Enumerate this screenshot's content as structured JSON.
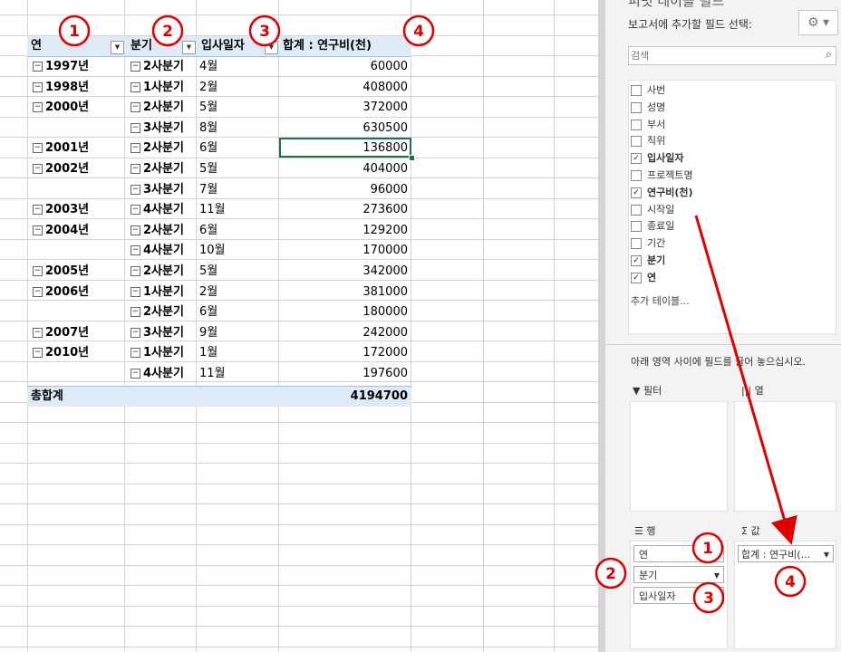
{
  "pivot": {
    "header": {
      "c1": "연",
      "c2": "분기",
      "c3": "입사일자",
      "c4": "합계 : 연구비(천)"
    },
    "rows": [
      {
        "year": "1997년",
        "quarter": "2사분기",
        "month": "4월",
        "value": "60000"
      },
      {
        "year": "1998년",
        "quarter": "1사분기",
        "month": "2월",
        "value": "408000"
      },
      {
        "year": "2000년",
        "quarter": "2사분기",
        "month": "5월",
        "value": "372000"
      },
      {
        "year": "",
        "quarter": "3사분기",
        "month": "8월",
        "value": "630500"
      },
      {
        "year": "2001년",
        "quarter": "2사분기",
        "month": "6월",
        "value": "136800"
      },
      {
        "year": "2002년",
        "quarter": "2사분기",
        "month": "5월",
        "value": "404000"
      },
      {
        "year": "",
        "quarter": "3사분기",
        "month": "7월",
        "value": "96000"
      },
      {
        "year": "2003년",
        "quarter": "4사분기",
        "month": "11월",
        "value": "273600"
      },
      {
        "year": "2004년",
        "quarter": "2사분기",
        "month": "6월",
        "value": "129200"
      },
      {
        "year": "",
        "quarter": "4사분기",
        "month": "10월",
        "value": "170000"
      },
      {
        "year": "2005년",
        "quarter": "2사분기",
        "month": "5월",
        "value": "342000"
      },
      {
        "year": "2006년",
        "quarter": "1사분기",
        "month": "2월",
        "value": "381000"
      },
      {
        "year": "",
        "quarter": "2사분기",
        "month": "6월",
        "value": "180000"
      },
      {
        "year": "2007년",
        "quarter": "3사분기",
        "month": "9월",
        "value": "242000"
      },
      {
        "year": "2010년",
        "quarter": "1사분기",
        "month": "1월",
        "value": "172000"
      },
      {
        "year": "",
        "quarter": "4사분기",
        "month": "11월",
        "value": "197600"
      }
    ],
    "total": {
      "label": "총합계",
      "value": "4194700"
    },
    "collapse_glyph": "⊟"
  },
  "panel": {
    "title": "피벗 테이블 필드",
    "prompt": "보고서에 추가할 필드 선택:",
    "search_placeholder": "검색",
    "fields": [
      {
        "label": "사번",
        "checked": false
      },
      {
        "label": "성명",
        "checked": false
      },
      {
        "label": "부서",
        "checked": false
      },
      {
        "label": "직위",
        "checked": false
      },
      {
        "label": "입사일자",
        "checked": true
      },
      {
        "label": "프로젝트명",
        "checked": false
      },
      {
        "label": "연구비(천)",
        "checked": true
      },
      {
        "label": "시작일",
        "checked": false
      },
      {
        "label": "종료일",
        "checked": false
      },
      {
        "label": "기간",
        "checked": false
      },
      {
        "label": "분기",
        "checked": true
      },
      {
        "label": "연",
        "checked": true
      }
    ],
    "more_tables": "추가 테이블...",
    "instruction": "아래 영역 사이에 필드를 끌어 놓으십시오.",
    "areas": {
      "filter": "필터",
      "columns": "열",
      "rows": "행",
      "values": "값",
      "row_fields": [
        "연",
        "분기",
        "입사일자"
      ],
      "value_fields": [
        "합계 : 연구비(..."
      ]
    }
  },
  "annotations": {
    "marks": [
      "1",
      "2",
      "3",
      "4"
    ],
    "color": "#e00000"
  }
}
